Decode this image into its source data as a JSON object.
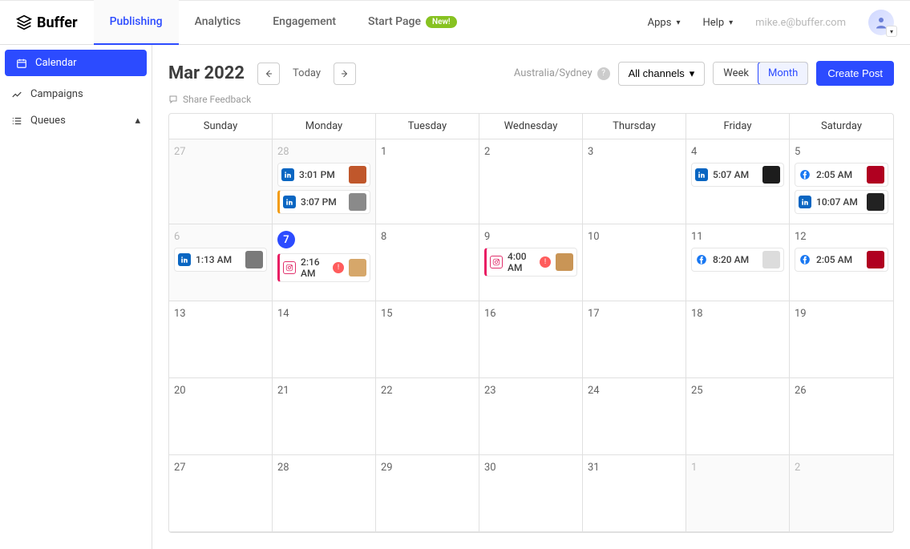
{
  "brand": "Buffer",
  "nav": {
    "tabs": [
      {
        "label": "Publishing",
        "active": true
      },
      {
        "label": "Analytics"
      },
      {
        "label": "Engagement"
      },
      {
        "label": "Start Page",
        "badge": "New!"
      }
    ],
    "apps": "Apps",
    "help": "Help",
    "user_email": "mike.e@buffer.com"
  },
  "sidebar": {
    "items": [
      {
        "label": "Calendar",
        "icon": "calendar",
        "active": true
      },
      {
        "label": "Campaigns",
        "icon": "trend"
      },
      {
        "label": "Queues",
        "icon": "list",
        "expandable": true
      }
    ]
  },
  "calendar": {
    "title": "Mar 2022",
    "today": "Today",
    "timezone": "Australia/Sydney",
    "channels_label": "All channels",
    "view": {
      "week": "Week",
      "month": "Month",
      "active": "Month"
    },
    "create": "Create Post",
    "feedback": "Share Feedback",
    "days": [
      "Sunday",
      "Monday",
      "Tuesday",
      "Wednesday",
      "Thursday",
      "Friday",
      "Saturday"
    ],
    "weeks": [
      [
        {
          "num": "27",
          "muted": true
        },
        {
          "num": "28",
          "muted": true,
          "posts": [
            {
              "net": "linkedin",
              "time": "3:01 PM",
              "thumb": "#c0572b"
            },
            {
              "net": "linkedin",
              "time": "3:07 PM",
              "bar": "orange",
              "thumb": "#8a8a8a"
            }
          ]
        },
        {
          "num": "1"
        },
        {
          "num": "2"
        },
        {
          "num": "3"
        },
        {
          "num": "4",
          "posts": [
            {
              "net": "linkedin",
              "time": "5:07 AM",
              "thumb": "#1c1c1c"
            }
          ]
        },
        {
          "num": "5",
          "posts": [
            {
              "net": "facebook",
              "time": "2:05 AM",
              "thumb": "#b00020"
            },
            {
              "net": "linkedin",
              "time": "10:07 AM",
              "thumb": "#222"
            }
          ]
        }
      ],
      [
        {
          "num": "6",
          "muted": true,
          "posts": [
            {
              "net": "linkedin",
              "time": "1:13 AM",
              "thumb": "#7a7a7a"
            }
          ]
        },
        {
          "num": "7",
          "today": true,
          "posts": [
            {
              "net": "instagram",
              "time": "2:16 AM",
              "bar": "pink",
              "status": true,
              "thumb": "#d6a76a"
            }
          ]
        },
        {
          "num": "8"
        },
        {
          "num": "9",
          "posts": [
            {
              "net": "instagram",
              "time": "4:00 AM",
              "bar": "pink",
              "status": true,
              "thumb": "#c99556"
            }
          ]
        },
        {
          "num": "10"
        },
        {
          "num": "11",
          "posts": [
            {
              "net": "facebook",
              "time": "8:20 AM",
              "thumb": "#dcdcdc"
            }
          ]
        },
        {
          "num": "12",
          "posts": [
            {
              "net": "facebook",
              "time": "2:05 AM",
              "thumb": "#b00020"
            }
          ]
        }
      ],
      [
        {
          "num": "13"
        },
        {
          "num": "14"
        },
        {
          "num": "15"
        },
        {
          "num": "16"
        },
        {
          "num": "17"
        },
        {
          "num": "18"
        },
        {
          "num": "19"
        }
      ],
      [
        {
          "num": "20"
        },
        {
          "num": "21"
        },
        {
          "num": "22"
        },
        {
          "num": "23"
        },
        {
          "num": "24"
        },
        {
          "num": "25"
        },
        {
          "num": "26"
        }
      ],
      [
        {
          "num": "27"
        },
        {
          "num": "28"
        },
        {
          "num": "29"
        },
        {
          "num": "30"
        },
        {
          "num": "31"
        },
        {
          "num": "1",
          "next": true
        },
        {
          "num": "2",
          "next": true
        }
      ]
    ]
  }
}
